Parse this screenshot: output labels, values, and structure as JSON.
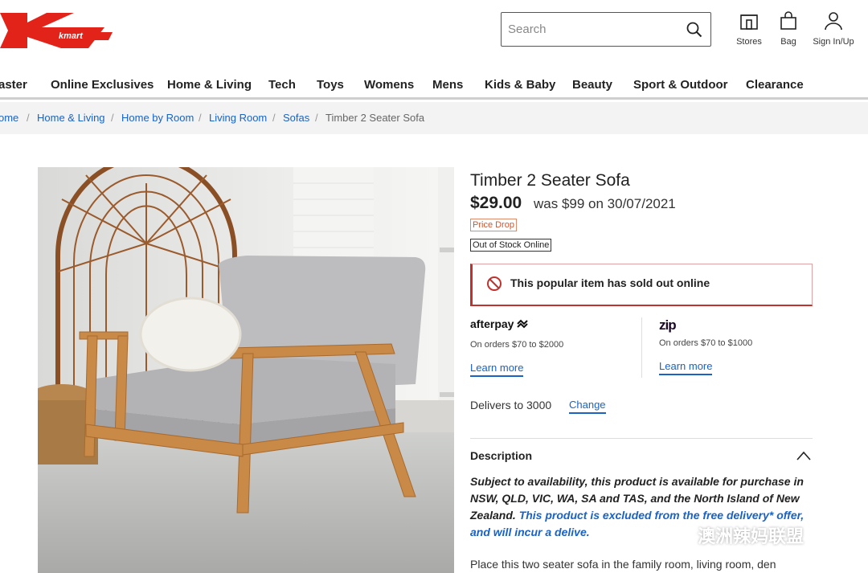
{
  "brand": {
    "logo_text": "kmart",
    "accent": "#e2231a"
  },
  "search": {
    "placeholder": "Search"
  },
  "header_links": [
    {
      "label": "Stores",
      "icon": "store-icon"
    },
    {
      "label": "Bag",
      "icon": "bag-icon"
    },
    {
      "label": "Sign In/Up",
      "icon": "user-icon"
    }
  ],
  "nav": [
    "aster",
    "Online Exclusives",
    "Home & Living",
    "Tech",
    "Toys",
    "Womens",
    "Mens",
    "Kids & Baby",
    "Beauty",
    "Sport & Outdoor",
    "Clearance"
  ],
  "breadcrumb": {
    "items": [
      "ome",
      "Home & Living",
      "Home by Room",
      "Living Room",
      "Sofas"
    ],
    "current": "Timber 2 Seater Sofa",
    "separator": "/"
  },
  "product": {
    "title": "Timber 2 Seater Sofa",
    "price": "$29.00",
    "was": "was $99 on 30/07/2021",
    "badge_drop": "Price Drop",
    "badge_stock": "Out of Stock Online",
    "alert": "This popular item has sold out online"
  },
  "payments": {
    "afterpay": {
      "logo": "afterpay",
      "sub": "On orders $70 to $2000",
      "link": "Learn more"
    },
    "zip": {
      "logo": "zip",
      "sub": "On orders $70 to $1000",
      "link": "Learn more"
    }
  },
  "delivery": {
    "text": "Delivers to 3000",
    "change": "Change"
  },
  "description": {
    "heading": "Description",
    "availability": "Subject to availability, this product is available for purchase in NSW, QLD, VIC, WA, SA and TAS, and the North Island of New Zealand.",
    "excluded": "This product is excluded from the free delivery* offer, and will incur a deliv",
    "excluded_tail": "e.",
    "body": "Place this two seater sofa in the family room, living room, den"
  },
  "watermark": "澳洲辣妈联盟"
}
